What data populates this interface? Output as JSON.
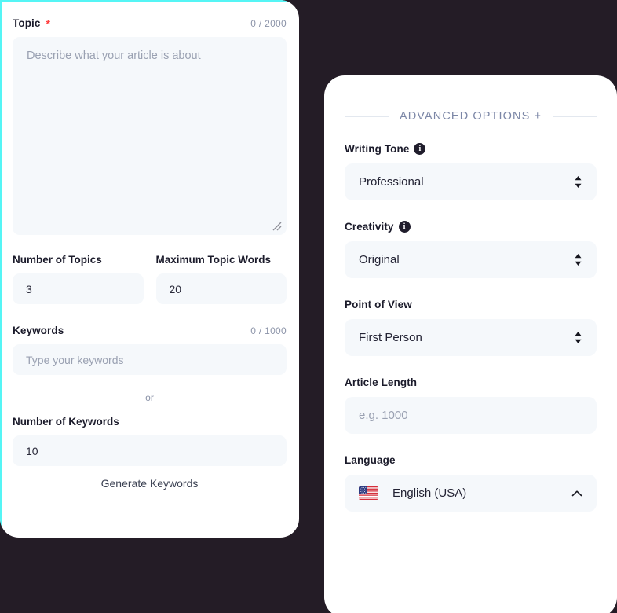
{
  "theme": {
    "page_background": "#241c26",
    "card_background": "#ffffff",
    "accent_cyan": "#55f5f5",
    "input_background": "#f5f8fb",
    "required_star_color": "#ff3b3b",
    "muted_text": "#8b93a8",
    "heading_text": "#1b1b2b"
  },
  "left_card": {
    "topic": {
      "label": "Topic",
      "required_marker": "*",
      "counter": "0 / 2000",
      "placeholder": "Describe what your article is about",
      "value": "",
      "resize_grip_icon": "resize-grip-icon"
    },
    "number_of_topics": {
      "label": "Number of Topics",
      "value": "3"
    },
    "maximum_topic_words": {
      "label": "Maximum Topic Words",
      "value": "20"
    },
    "keywords": {
      "label": "Keywords",
      "counter": "0 / 1000",
      "placeholder": "Type your keywords",
      "value": ""
    },
    "or_divider": "or",
    "number_of_keywords": {
      "label": "Number of Keywords",
      "value": "10"
    },
    "generate_keywords_button": "Generate Keywords"
  },
  "right_card": {
    "header": {
      "title": "ADVANCED OPTIONS +"
    },
    "writing_tone": {
      "label": "Writing Tone",
      "info_icon": "info-icon",
      "value": "Professional",
      "control_icon": "up-down-arrows-icon"
    },
    "creativity": {
      "label": "Creativity",
      "info_icon": "info-icon",
      "value": "Original",
      "control_icon": "up-down-arrows-icon"
    },
    "point_of_view": {
      "label": "Point of View",
      "value": "First Person",
      "control_icon": "up-down-arrows-icon"
    },
    "article_length": {
      "label": "Article Length",
      "placeholder": "e.g. 1000",
      "value": ""
    },
    "language": {
      "label": "Language",
      "flag_icon": "us-flag-icon",
      "value": "English (USA)",
      "control_icon": "chevron-up-icon"
    }
  }
}
